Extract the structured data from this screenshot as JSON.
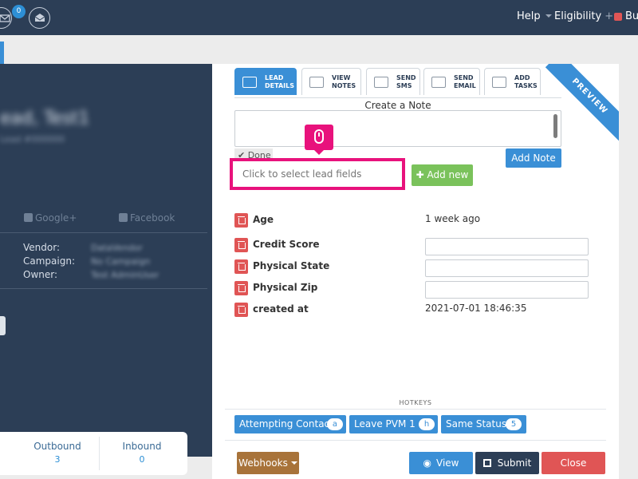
{
  "topnav": {
    "mail_badge": "0",
    "help_label": "Help",
    "eligibility_label": "Eligibility",
    "truncated_label": "Bu"
  },
  "lead_profile": {
    "social": [
      "Google+",
      "Facebook"
    ],
    "info_labels": [
      "Vendor:",
      "Campaign:",
      "Owner:"
    ]
  },
  "stats": [
    {
      "label": "Outbound",
      "value": "3"
    },
    {
      "label": "Inbound",
      "value": "0"
    }
  ],
  "ribbon": "PREVIEW",
  "tabs": [
    {
      "line1": "LEAD",
      "line2": "DETAILS",
      "active": true
    },
    {
      "line1": "VIEW",
      "line2": "NOTES",
      "active": false
    },
    {
      "line1": "SEND",
      "line2": "SMS",
      "active": false
    },
    {
      "line1": "SEND",
      "line2": "EMAIL",
      "active": false
    },
    {
      "line1": "ADD",
      "line2": "TASKS",
      "active": false
    }
  ],
  "note": {
    "title": "Create a Note",
    "done_label": "✔ Done",
    "add_note_label": "Add Note"
  },
  "lead_fields": {
    "placeholder": "Click to select lead fields",
    "add_new_label": "✚ Add new"
  },
  "fields": [
    {
      "name": "Age",
      "value": "1 week ago",
      "type": "text"
    },
    {
      "name": "Credit Score",
      "value": "",
      "type": "input"
    },
    {
      "name": "Physical State",
      "value": "",
      "type": "input"
    },
    {
      "name": "Physical Zip",
      "value": "",
      "type": "input"
    },
    {
      "name": "created at",
      "value": "2021-07-01 18:46:35",
      "type": "text"
    }
  ],
  "hotkeys": {
    "label": "HOTKEYS",
    "items": [
      {
        "label": "Attempting Contact",
        "key": "a"
      },
      {
        "label": "Leave PVM 1",
        "key": "h"
      },
      {
        "label": "Same Status",
        "key": "5"
      }
    ]
  },
  "actions": {
    "webhooks": "Webhooks",
    "view": "View",
    "submit": "Submit",
    "close": "Close"
  },
  "colors": {
    "navy": "#2c3e56",
    "primary": "#3a8fd6",
    "success": "#7ac25b",
    "danger": "#e05555",
    "highlight": "#e8127c",
    "webhooks": "#a8733a"
  }
}
